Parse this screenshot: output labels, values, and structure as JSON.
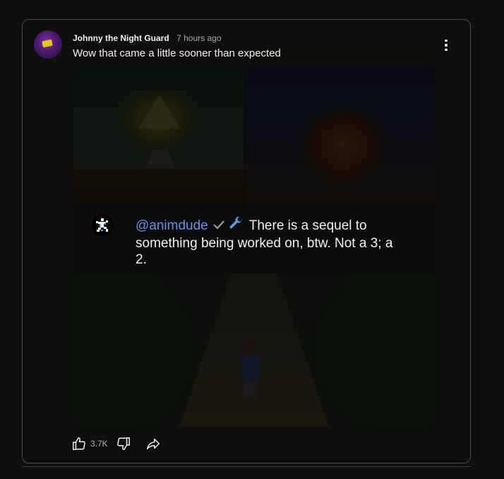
{
  "comment": {
    "author": "Johnny the Night Guard",
    "timestamp": "7 hours ago",
    "text": "Wow that came a little sooner than expected"
  },
  "quote": {
    "mention": "@animdude",
    "text": "There is a sequel to something being worked on, btw. Not a 3; a 2."
  },
  "actions": {
    "like_count": "3.7K"
  },
  "icons": {
    "more": "more-vertical-icon",
    "like": "thumbs-up-icon",
    "dislike": "thumbs-down-icon",
    "share": "share-icon",
    "verified": "check-icon",
    "wrench": "wrench-icon"
  },
  "colors": {
    "background": "#0f0f0f",
    "text_primary": "#f1f1f1",
    "text_secondary": "#aaaaaa",
    "mention": "#6a8fe6",
    "wrench": "#5b9cf0"
  }
}
